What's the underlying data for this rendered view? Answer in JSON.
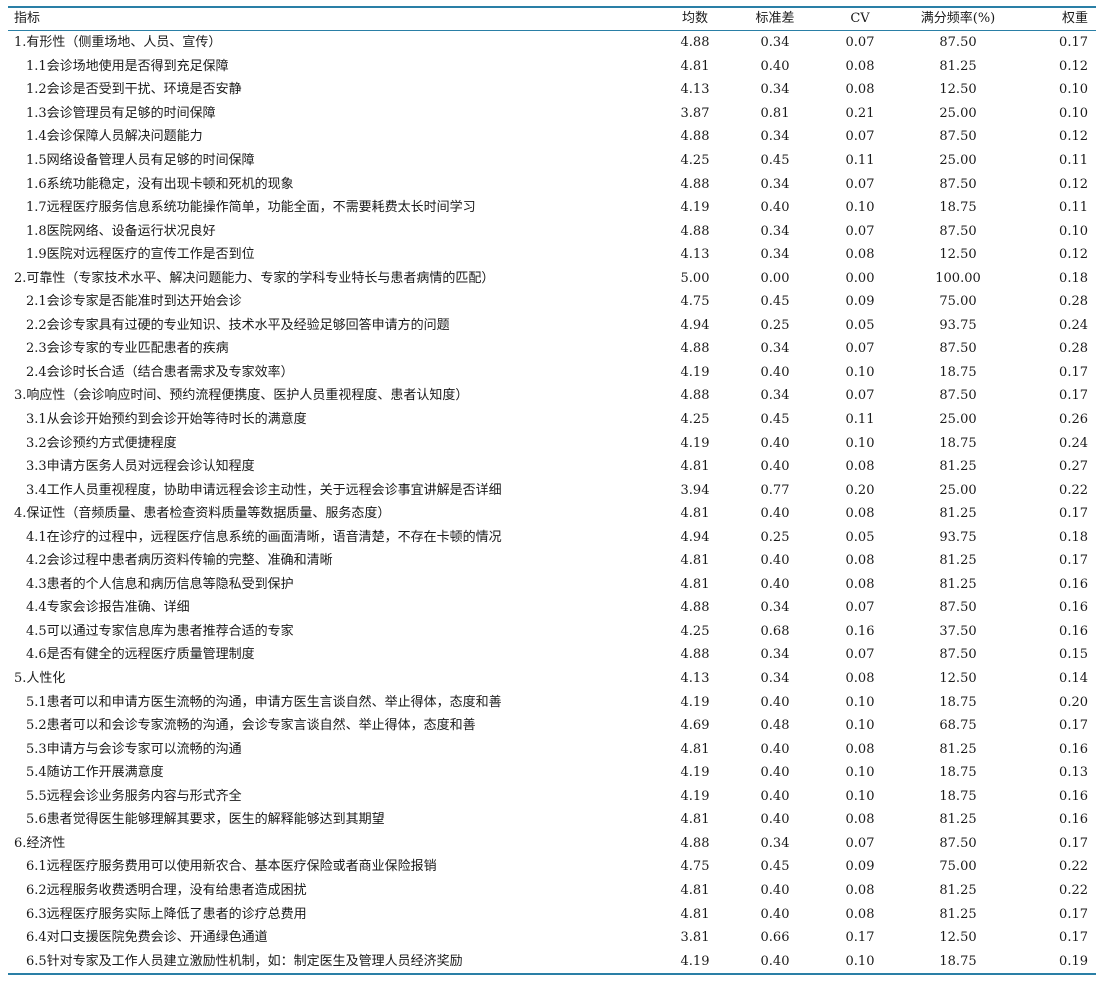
{
  "header": [
    "指标",
    "均数",
    "标准差",
    "CV",
    "满分频率(%)",
    "权重"
  ],
  "rows": [
    {
      "name": "1.有形性（侧重场地、人员、宣传）",
      "level": 1,
      "mean": "4.88",
      "sd": "0.34",
      "cv": "0.07",
      "full": "87.50",
      "weight": "0.17"
    },
    {
      "name": "1.1会诊场地使用是否得到充足保障",
      "level": 2,
      "mean": "4.81",
      "sd": "0.40",
      "cv": "0.08",
      "full": "81.25",
      "weight": "0.12"
    },
    {
      "name": "1.2会诊是否受到干扰、环境是否安静",
      "level": 2,
      "mean": "4.13",
      "sd": "0.34",
      "cv": "0.08",
      "full": "12.50",
      "weight": "0.10"
    },
    {
      "name": "1.3会诊管理员有足够的时间保障",
      "level": 2,
      "mean": "3.87",
      "sd": "0.81",
      "cv": "0.21",
      "full": "25.00",
      "weight": "0.10"
    },
    {
      "name": "1.4会诊保障人员解决问题能力",
      "level": 2,
      "mean": "4.88",
      "sd": "0.34",
      "cv": "0.07",
      "full": "87.50",
      "weight": "0.12"
    },
    {
      "name": "1.5网络设备管理人员有足够的时间保障",
      "level": 2,
      "mean": "4.25",
      "sd": "0.45",
      "cv": "0.11",
      "full": "25.00",
      "weight": "0.11"
    },
    {
      "name": "1.6系统功能稳定，没有出现卡顿和死机的现象",
      "level": 2,
      "mean": "4.88",
      "sd": "0.34",
      "cv": "0.07",
      "full": "87.50",
      "weight": "0.12"
    },
    {
      "name": "1.7远程医疗服务信息系统功能操作简单，功能全面，不需要耗费太长时间学习",
      "level": 2,
      "mean": "4.19",
      "sd": "0.40",
      "cv": "0.10",
      "full": "18.75",
      "weight": "0.11"
    },
    {
      "name": "1.8医院网络、设备运行状况良好",
      "level": 2,
      "mean": "4.88",
      "sd": "0.34",
      "cv": "0.07",
      "full": "87.50",
      "weight": "0.10"
    },
    {
      "name": "1.9医院对远程医疗的宣传工作是否到位",
      "level": 2,
      "mean": "4.13",
      "sd": "0.34",
      "cv": "0.08",
      "full": "12.50",
      "weight": "0.12"
    },
    {
      "name": "2.可靠性（专家技术水平、解决问题能力、专家的学科专业特长与患者病情的匹配）",
      "level": 1,
      "mean": "5.00",
      "sd": "0.00",
      "cv": "0.00",
      "full": "100.00",
      "weight": "0.18"
    },
    {
      "name": "2.1会诊专家是否能准时到达开始会诊",
      "level": 2,
      "mean": "4.75",
      "sd": "0.45",
      "cv": "0.09",
      "full": "75.00",
      "weight": "0.28"
    },
    {
      "name": "2.2会诊专家具有过硬的专业知识、技术水平及经验足够回答申请方的问题",
      "level": 2,
      "mean": "4.94",
      "sd": "0.25",
      "cv": "0.05",
      "full": "93.75",
      "weight": "0.24"
    },
    {
      "name": "2.3会诊专家的专业匹配患者的疾病",
      "level": 2,
      "mean": "4.88",
      "sd": "0.34",
      "cv": "0.07",
      "full": "87.50",
      "weight": "0.28"
    },
    {
      "name": "2.4会诊时长合适（结合患者需求及专家效率）",
      "level": 2,
      "mean": "4.19",
      "sd": "0.40",
      "cv": "0.10",
      "full": "18.75",
      "weight": "0.17"
    },
    {
      "name": "3.响应性（会诊响应时间、预约流程便携度、医护人员重视程度、患者认知度）",
      "level": 1,
      "mean": "4.88",
      "sd": "0.34",
      "cv": "0.07",
      "full": "87.50",
      "weight": "0.17"
    },
    {
      "name": "3.1从会诊开始预约到会诊开始等待时长的满意度",
      "level": 2,
      "mean": "4.25",
      "sd": "0.45",
      "cv": "0.11",
      "full": "25.00",
      "weight": "0.26"
    },
    {
      "name": "3.2会诊预约方式便捷程度",
      "level": 2,
      "mean": "4.19",
      "sd": "0.40",
      "cv": "0.10",
      "full": "18.75",
      "weight": "0.24"
    },
    {
      "name": "3.3申请方医务人员对远程会诊认知程度",
      "level": 2,
      "mean": "4.81",
      "sd": "0.40",
      "cv": "0.08",
      "full": "81.25",
      "weight": "0.27"
    },
    {
      "name": "3.4工作人员重视程度，协助申请远程会诊主动性，关于远程会诊事宜讲解是否详细",
      "level": 2,
      "mean": "3.94",
      "sd": "0.77",
      "cv": "0.20",
      "full": "25.00",
      "weight": "0.22"
    },
    {
      "name": "4.保证性（音频质量、患者检查资料质量等数据质量、服务态度）",
      "level": 1,
      "mean": "4.81",
      "sd": "0.40",
      "cv": "0.08",
      "full": "81.25",
      "weight": "0.17"
    },
    {
      "name": "4.1在诊疗的过程中，远程医疗信息系统的画面清晰，语音清楚，不存在卡顿的情况",
      "level": 2,
      "mean": "4.94",
      "sd": "0.25",
      "cv": "0.05",
      "full": "93.75",
      "weight": "0.18"
    },
    {
      "name": "4.2会诊过程中患者病历资料传输的完整、准确和清晰",
      "level": 2,
      "mean": "4.81",
      "sd": "0.40",
      "cv": "0.08",
      "full": "81.25",
      "weight": "0.17"
    },
    {
      "name": "4.3患者的个人信息和病历信息等隐私受到保护",
      "level": 2,
      "mean": "4.81",
      "sd": "0.40",
      "cv": "0.08",
      "full": "81.25",
      "weight": "0.16"
    },
    {
      "name": "4.4专家会诊报告准确、详细",
      "level": 2,
      "mean": "4.88",
      "sd": "0.34",
      "cv": "0.07",
      "full": "87.50",
      "weight": "0.16"
    },
    {
      "name": "4.5可以通过专家信息库为患者推荐合适的专家",
      "level": 2,
      "mean": "4.25",
      "sd": "0.68",
      "cv": "0.16",
      "full": "37.50",
      "weight": "0.16"
    },
    {
      "name": "4.6是否有健全的远程医疗质量管理制度",
      "level": 2,
      "mean": "4.88",
      "sd": "0.34",
      "cv": "0.07",
      "full": "87.50",
      "weight": "0.15"
    },
    {
      "name": "5.人性化",
      "level": 1,
      "mean": "4.13",
      "sd": "0.34",
      "cv": "0.08",
      "full": "12.50",
      "weight": "0.14"
    },
    {
      "name": "5.1患者可以和申请方医生流畅的沟通，申请方医生言谈自然、举止得体，态度和善",
      "level": 2,
      "mean": "4.19",
      "sd": "0.40",
      "cv": "0.10",
      "full": "18.75",
      "weight": "0.20"
    },
    {
      "name": "5.2患者可以和会诊专家流畅的沟通，会诊专家言谈自然、举止得体，态度和善",
      "level": 2,
      "mean": "4.69",
      "sd": "0.48",
      "cv": "0.10",
      "full": "68.75",
      "weight": "0.17"
    },
    {
      "name": "5.3申请方与会诊专家可以流畅的沟通",
      "level": 2,
      "mean": "4.81",
      "sd": "0.40",
      "cv": "0.08",
      "full": "81.25",
      "weight": "0.16"
    },
    {
      "name": "5.4随访工作开展满意度",
      "level": 2,
      "mean": "4.19",
      "sd": "0.40",
      "cv": "0.10",
      "full": "18.75",
      "weight": "0.13"
    },
    {
      "name": "5.5远程会诊业务服务内容与形式齐全",
      "level": 2,
      "mean": "4.19",
      "sd": "0.40",
      "cv": "0.10",
      "full": "18.75",
      "weight": "0.16"
    },
    {
      "name": "5.6患者觉得医生能够理解其要求，医生的解释能够达到其期望",
      "level": 2,
      "mean": "4.81",
      "sd": "0.40",
      "cv": "0.08",
      "full": "81.25",
      "weight": "0.16"
    },
    {
      "name": "6.经济性",
      "level": 1,
      "mean": "4.88",
      "sd": "0.34",
      "cv": "0.07",
      "full": "87.50",
      "weight": "0.17"
    },
    {
      "name": "6.1远程医疗服务费用可以使用新农合、基本医疗保险或者商业保险报销",
      "level": 2,
      "mean": "4.75",
      "sd": "0.45",
      "cv": "0.09",
      "full": "75.00",
      "weight": "0.22"
    },
    {
      "name": "6.2远程服务收费透明合理，没有给患者造成困扰",
      "level": 2,
      "mean": "4.81",
      "sd": "0.40",
      "cv": "0.08",
      "full": "81.25",
      "weight": "0.22"
    },
    {
      "name": "6.3远程医疗服务实际上降低了患者的诊疗总费用",
      "level": 2,
      "mean": "4.81",
      "sd": "0.40",
      "cv": "0.08",
      "full": "81.25",
      "weight": "0.17"
    },
    {
      "name": "6.4对口支援医院免费会诊、开通绿色通道",
      "level": 2,
      "mean": "3.81",
      "sd": "0.66",
      "cv": "0.17",
      "full": "12.50",
      "weight": "0.17"
    },
    {
      "name": "6.5针对专家及工作人员建立激励性机制，如：制定医生及管理人员经济奖励",
      "level": 2,
      "mean": "4.19",
      "sd": "0.40",
      "cv": "0.10",
      "full": "18.75",
      "weight": "0.19"
    }
  ]
}
